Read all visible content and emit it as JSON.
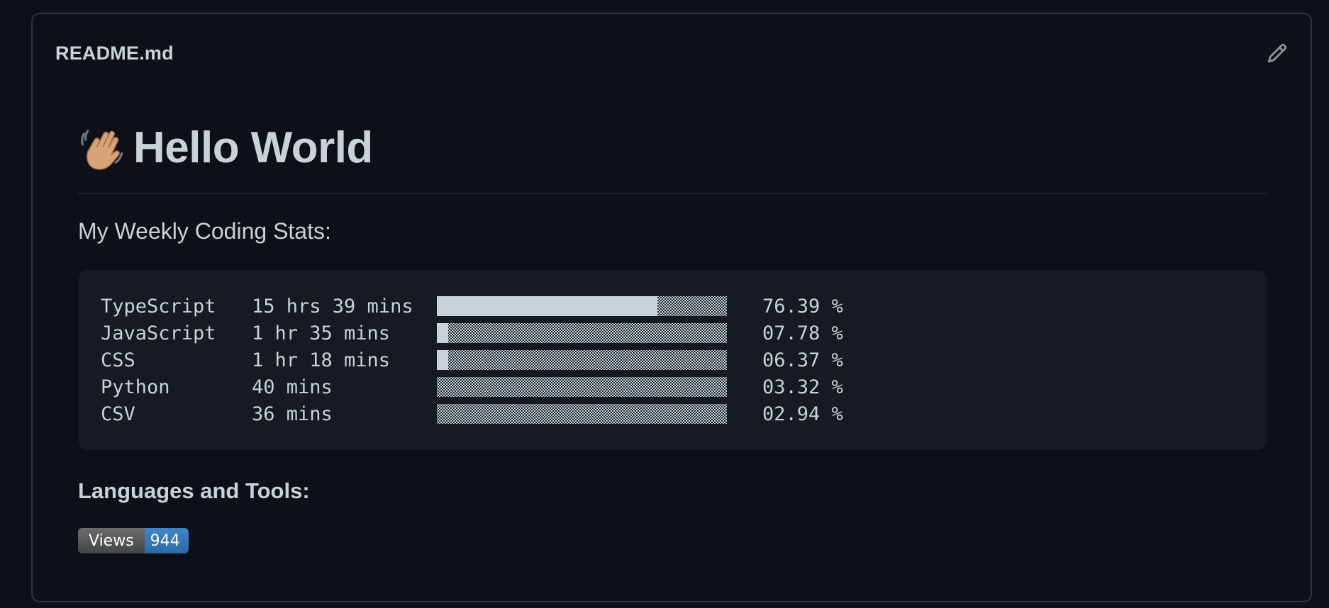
{
  "readme": {
    "filename": "README.md"
  },
  "profile": {
    "title": "Hello World",
    "title_icon": "waving-hand-icon",
    "subtitle": "My Weekly Coding Stats:",
    "stats": [
      {
        "language": "TypeScript",
        "time": "15 hrs 39 mins",
        "percent_label": "76.39 %",
        "percent": 76.39
      },
      {
        "language": "JavaScript",
        "time": "1 hr 35 mins",
        "percent_label": "07.78 %",
        "percent": 7.78
      },
      {
        "language": "CSS",
        "time": "1 hr 18 mins",
        "percent_label": "06.37 %",
        "percent": 6.37
      },
      {
        "language": "Python",
        "time": "40 mins",
        "percent_label": "03.32 %",
        "percent": 3.32
      },
      {
        "language": "CSV",
        "time": "36 mins",
        "percent_label": "02.94 %",
        "percent": 2.94
      }
    ],
    "tools_heading": "Languages and Tools:",
    "badge": {
      "label": "Views",
      "value": "944"
    }
  },
  "colors": {
    "background": "#0d1117",
    "code_background": "#161b22",
    "border": "#30363d",
    "text": "#c9d1d9",
    "badge_blue": "#2b6aa6"
  },
  "icons": {
    "edit": "pencil-icon"
  }
}
